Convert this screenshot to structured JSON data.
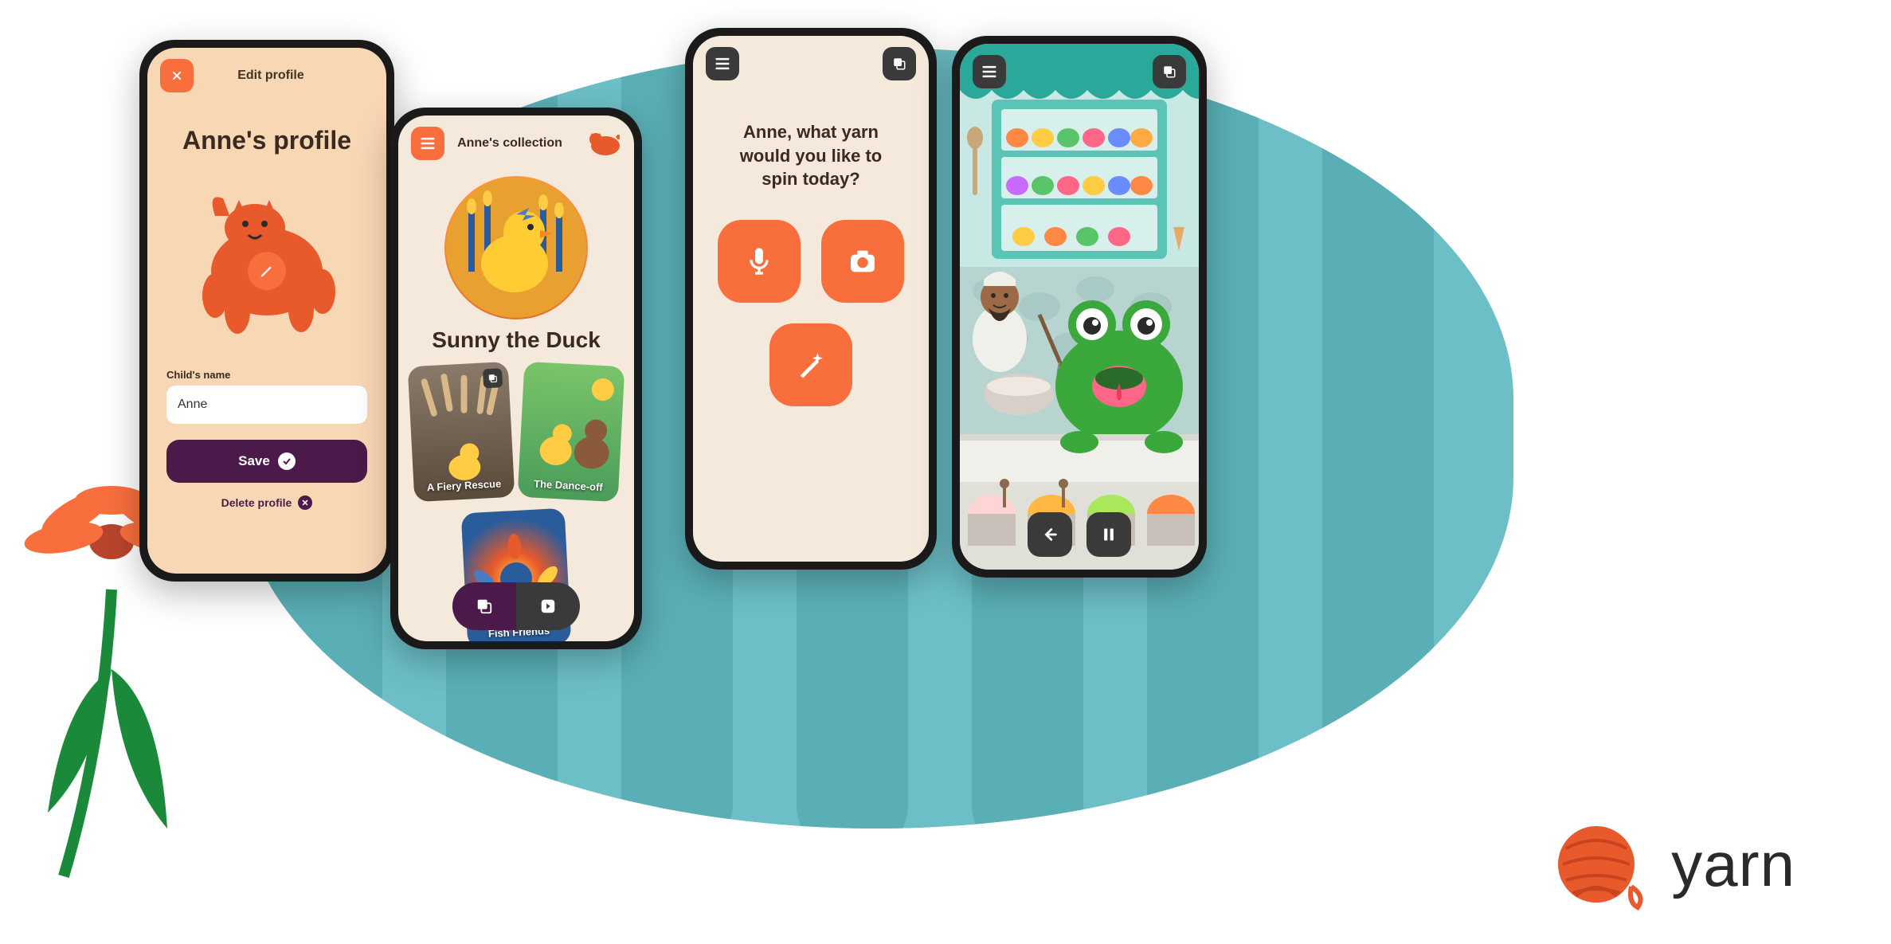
{
  "brand": {
    "name": "yarn"
  },
  "profile": {
    "header_title": "Edit profile",
    "heading": "Anne's profile",
    "name_label": "Child's name",
    "name_value": "Anne",
    "save_label": "Save",
    "delete_label": "Delete profile",
    "avatar_icon": "cat-icon",
    "edit_icon": "pencil-icon"
  },
  "collection": {
    "header_title": "Anne's collection",
    "character_name": "Sunny the Duck",
    "stories": [
      {
        "title": "A Fiery Rescue"
      },
      {
        "title": "The Dance-off"
      },
      {
        "title": "Fish Friends"
      }
    ],
    "nav_icons": [
      "layers-icon",
      "forward-icon"
    ]
  },
  "prompt": {
    "heading": "Anne, what yarn would you like to spin today?",
    "actions": [
      "microphone",
      "camera",
      "magic-wand"
    ]
  },
  "player": {
    "scene": "frog-chef-ice-cream-shop",
    "controls": [
      "back",
      "pause"
    ]
  }
}
